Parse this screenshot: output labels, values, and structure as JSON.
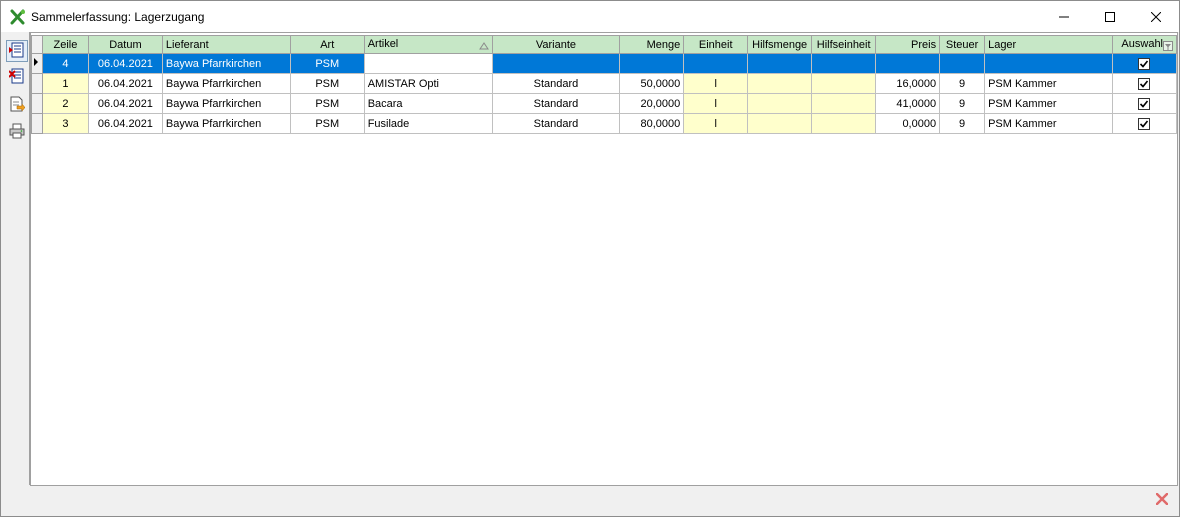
{
  "window": {
    "title": "Sammelerfassung: Lagerzugang"
  },
  "columns": [
    {
      "key": "zeile",
      "label": "Zeile"
    },
    {
      "key": "datum",
      "label": "Datum"
    },
    {
      "key": "lieferant",
      "label": "Lieferant"
    },
    {
      "key": "art",
      "label": "Art"
    },
    {
      "key": "artikel",
      "label": "Artikel"
    },
    {
      "key": "variante",
      "label": "Variante"
    },
    {
      "key": "menge",
      "label": "Menge"
    },
    {
      "key": "einheit",
      "label": "Einheit"
    },
    {
      "key": "hilfsmenge",
      "label": "Hilfsmenge"
    },
    {
      "key": "hilfseinheit",
      "label": "Hilfseinheit"
    },
    {
      "key": "preis",
      "label": "Preis"
    },
    {
      "key": "steuer",
      "label": "Steuer"
    },
    {
      "key": "lager",
      "label": "Lager"
    },
    {
      "key": "auswahl",
      "label": "Auswahl"
    }
  ],
  "rows": [
    {
      "zeile": "4",
      "datum": "06.04.2021",
      "lieferant": "Baywa Pfarrkirchen",
      "art": "PSM",
      "artikel": "",
      "variante": "",
      "menge": "",
      "einheit": "",
      "hilfsmenge": "",
      "hilfseinheit": "",
      "preis": "",
      "steuer": "",
      "lager": "",
      "auswahl": true
    },
    {
      "zeile": "1",
      "datum": "06.04.2021",
      "lieferant": "Baywa Pfarrkirchen",
      "art": "PSM",
      "artikel": "AMISTAR Opti",
      "variante": "Standard",
      "menge": "50,0000",
      "einheit": "l",
      "hilfsmenge": "",
      "hilfseinheit": "",
      "preis": "16,0000",
      "steuer": "9",
      "lager": "PSM Kammer",
      "auswahl": true
    },
    {
      "zeile": "2",
      "datum": "06.04.2021",
      "lieferant": "Baywa Pfarrkirchen",
      "art": "PSM",
      "artikel": "Bacara",
      "variante": "Standard",
      "menge": "20,0000",
      "einheit": "l",
      "hilfsmenge": "",
      "hilfseinheit": "",
      "preis": "41,0000",
      "steuer": "9",
      "lager": "PSM Kammer",
      "auswahl": true
    },
    {
      "zeile": "3",
      "datum": "06.04.2021",
      "lieferant": "Baywa Pfarrkirchen",
      "art": "PSM",
      "artikel": "Fusilade",
      "variante": "Standard",
      "menge": "80,0000",
      "einheit": "l",
      "hilfsmenge": "",
      "hilfseinheit": "",
      "preis": "0,0000",
      "steuer": "9",
      "lager": "PSM Kammer",
      "auswahl": true
    }
  ],
  "toolbar": {
    "icons": [
      "new-record-icon",
      "delete-record-icon",
      "export-icon",
      "print-icon"
    ]
  },
  "colors": {
    "header_bg": "#c6e7c6",
    "selected_bg": "#0078d7",
    "yellow_cell": "#ffffcc"
  }
}
